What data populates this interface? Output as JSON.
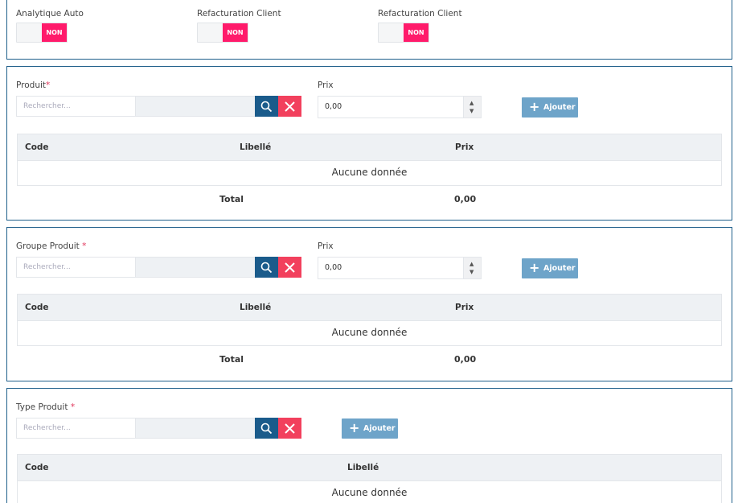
{
  "toggles": [
    {
      "label": "Analytique Auto",
      "state": "NON"
    },
    {
      "label": "Refacturation Client",
      "state": "NON"
    },
    {
      "label": "Refacturation Client",
      "state": "NON"
    }
  ],
  "produit": {
    "label": "Produit",
    "required_mark": "*",
    "search_placeholder": "Rechercher...",
    "price_label": "Prix",
    "price_value": "0,00",
    "add_label": "Ajouter",
    "table": {
      "headers": [
        "Code",
        "Libellé",
        "Prix"
      ],
      "empty_text": "Aucune donnée",
      "total_label": "Total",
      "total_value": "0,00"
    }
  },
  "groupe_produit": {
    "label": "Groupe Produit ",
    "required_mark": "*",
    "search_placeholder": "Rechercher...",
    "price_label": "Prix",
    "price_value": "0,00",
    "add_label": "Ajouter",
    "table": {
      "headers": [
        "Code",
        "Libellé",
        "Prix"
      ],
      "empty_text": "Aucune donnée",
      "total_label": "Total",
      "total_value": "0,00"
    }
  },
  "type_produit": {
    "label": "Type Produit ",
    "required_mark": "*",
    "search_placeholder": "Rechercher...",
    "add_label": "Ajouter",
    "table": {
      "headers": [
        "Code",
        "Libellé"
      ],
      "empty_text": "Aucune donnée"
    }
  },
  "colors": {
    "toggle_off": "#ff1b6b",
    "search_button": "#1a5b8b",
    "clear_button": "#f2405d",
    "add_button": "#6ea4c9",
    "panel_border": "#1f5f8b",
    "required": "#e0355a"
  },
  "icons": {
    "search": "search-icon",
    "clear": "close-icon",
    "add": "plus-icon",
    "spin_up": "caret-up-icon",
    "spin_down": "caret-down-icon"
  }
}
